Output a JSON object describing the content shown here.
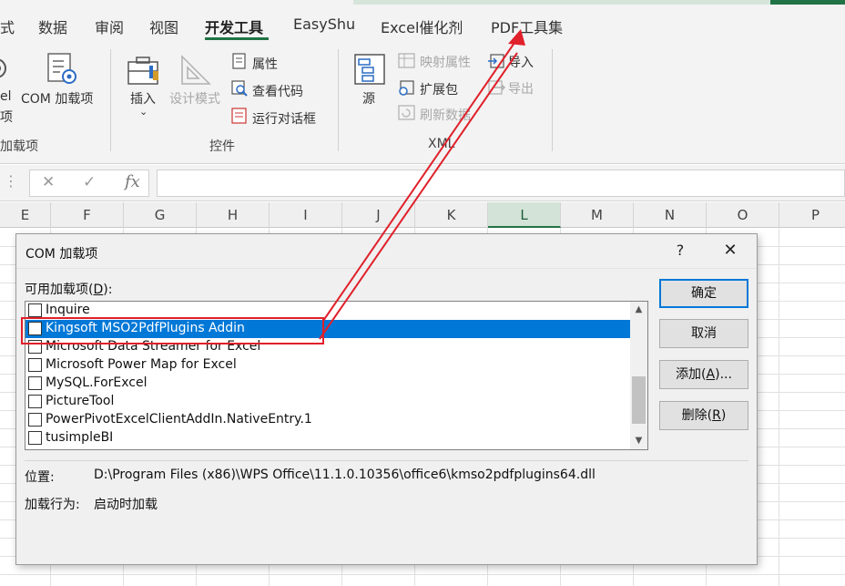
{
  "ribbon_tabs": [
    {
      "label": "式"
    },
    {
      "label": "数据"
    },
    {
      "label": "审阅"
    },
    {
      "label": "视图"
    },
    {
      "label": "开发工具"
    },
    {
      "label": "EasyShu"
    },
    {
      "label": "Excel催化剂"
    },
    {
      "label": "PDF工具集"
    }
  ],
  "ribbon": {
    "excel_addins_line1": "el",
    "excel_addins_line2": "项",
    "com_addins": "COM 加载项",
    "addins_group": "加载项",
    "insert": "插入",
    "design_mode": "设计模式",
    "properties": "属性",
    "view_code": "查看代码",
    "run_dialog": "运行对话框",
    "controls_group": "控件",
    "source": "源",
    "map_properties": "映射属性",
    "expansion_packs": "扩展包",
    "refresh_data": "刷新数据",
    "import": "导入",
    "export": "导出",
    "xml_group": "XML"
  },
  "formula_bar": {
    "cancel_icon": "✕",
    "enter_icon": "✓",
    "fx": "fx"
  },
  "columns": [
    "E",
    "F",
    "G",
    "H",
    "I",
    "J",
    "K",
    "L",
    "M",
    "N",
    "O",
    "P"
  ],
  "selected_column": "L",
  "dialog": {
    "title": "COM 加载项",
    "help": "?",
    "close": "✕",
    "available_label": "可用加载项(D):",
    "items": [
      {
        "label": "Inquire",
        "checked": false,
        "selected": false
      },
      {
        "label": "Kingsoft MSO2PdfPlugins Addin",
        "checked": false,
        "selected": true
      },
      {
        "label": "Microsoft Data Streamer for Excel",
        "checked": false,
        "selected": false
      },
      {
        "label": "Microsoft Power Map for Excel",
        "checked": false,
        "selected": false
      },
      {
        "label": "MySQL.ForExcel",
        "checked": false,
        "selected": false
      },
      {
        "label": "PictureTool",
        "checked": false,
        "selected": false
      },
      {
        "label": "PowerPivotExcelClientAddIn.NativeEntry.1",
        "checked": false,
        "selected": false
      },
      {
        "label": "tusimpleBI",
        "checked": false,
        "selected": false
      }
    ],
    "buttons": {
      "ok": "确定",
      "cancel": "取消",
      "add_prefix": "添加(",
      "add_key": "A",
      "add_suffix": ")...",
      "remove_prefix": "删除(",
      "remove_key": "R",
      "remove_suffix": ")"
    },
    "location_label": "位置:",
    "location_value": "D:\\Program Files (x86)\\WPS Office\\11.1.0.10356\\office6\\kmso2pdfplugins64.dll",
    "load_behavior_label": "加载行为:",
    "load_behavior_value": "启动时加载"
  },
  "colors": {
    "accent_green": "#217346",
    "selection_blue": "#0078d7",
    "annotation_red": "#e0202a"
  }
}
